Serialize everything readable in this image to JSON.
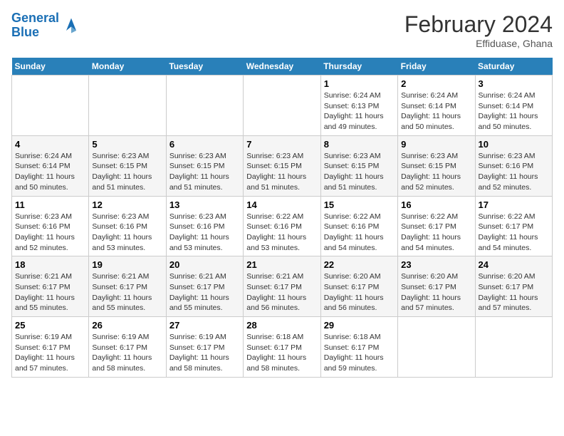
{
  "header": {
    "logo_line1": "General",
    "logo_line2": "Blue",
    "month_year": "February 2024",
    "location": "Effiduase, Ghana"
  },
  "days_of_week": [
    "Sunday",
    "Monday",
    "Tuesday",
    "Wednesday",
    "Thursday",
    "Friday",
    "Saturday"
  ],
  "weeks": [
    [
      {
        "num": "",
        "info": ""
      },
      {
        "num": "",
        "info": ""
      },
      {
        "num": "",
        "info": ""
      },
      {
        "num": "",
        "info": ""
      },
      {
        "num": "1",
        "info": "Sunrise: 6:24 AM\nSunset: 6:13 PM\nDaylight: 11 hours and 49 minutes."
      },
      {
        "num": "2",
        "info": "Sunrise: 6:24 AM\nSunset: 6:14 PM\nDaylight: 11 hours and 50 minutes."
      },
      {
        "num": "3",
        "info": "Sunrise: 6:24 AM\nSunset: 6:14 PM\nDaylight: 11 hours and 50 minutes."
      }
    ],
    [
      {
        "num": "4",
        "info": "Sunrise: 6:24 AM\nSunset: 6:14 PM\nDaylight: 11 hours and 50 minutes."
      },
      {
        "num": "5",
        "info": "Sunrise: 6:23 AM\nSunset: 6:15 PM\nDaylight: 11 hours and 51 minutes."
      },
      {
        "num": "6",
        "info": "Sunrise: 6:23 AM\nSunset: 6:15 PM\nDaylight: 11 hours and 51 minutes."
      },
      {
        "num": "7",
        "info": "Sunrise: 6:23 AM\nSunset: 6:15 PM\nDaylight: 11 hours and 51 minutes."
      },
      {
        "num": "8",
        "info": "Sunrise: 6:23 AM\nSunset: 6:15 PM\nDaylight: 11 hours and 51 minutes."
      },
      {
        "num": "9",
        "info": "Sunrise: 6:23 AM\nSunset: 6:15 PM\nDaylight: 11 hours and 52 minutes."
      },
      {
        "num": "10",
        "info": "Sunrise: 6:23 AM\nSunset: 6:16 PM\nDaylight: 11 hours and 52 minutes."
      }
    ],
    [
      {
        "num": "11",
        "info": "Sunrise: 6:23 AM\nSunset: 6:16 PM\nDaylight: 11 hours and 52 minutes."
      },
      {
        "num": "12",
        "info": "Sunrise: 6:23 AM\nSunset: 6:16 PM\nDaylight: 11 hours and 53 minutes."
      },
      {
        "num": "13",
        "info": "Sunrise: 6:23 AM\nSunset: 6:16 PM\nDaylight: 11 hours and 53 minutes."
      },
      {
        "num": "14",
        "info": "Sunrise: 6:22 AM\nSunset: 6:16 PM\nDaylight: 11 hours and 53 minutes."
      },
      {
        "num": "15",
        "info": "Sunrise: 6:22 AM\nSunset: 6:16 PM\nDaylight: 11 hours and 54 minutes."
      },
      {
        "num": "16",
        "info": "Sunrise: 6:22 AM\nSunset: 6:17 PM\nDaylight: 11 hours and 54 minutes."
      },
      {
        "num": "17",
        "info": "Sunrise: 6:22 AM\nSunset: 6:17 PM\nDaylight: 11 hours and 54 minutes."
      }
    ],
    [
      {
        "num": "18",
        "info": "Sunrise: 6:21 AM\nSunset: 6:17 PM\nDaylight: 11 hours and 55 minutes."
      },
      {
        "num": "19",
        "info": "Sunrise: 6:21 AM\nSunset: 6:17 PM\nDaylight: 11 hours and 55 minutes."
      },
      {
        "num": "20",
        "info": "Sunrise: 6:21 AM\nSunset: 6:17 PM\nDaylight: 11 hours and 55 minutes."
      },
      {
        "num": "21",
        "info": "Sunrise: 6:21 AM\nSunset: 6:17 PM\nDaylight: 11 hours and 56 minutes."
      },
      {
        "num": "22",
        "info": "Sunrise: 6:20 AM\nSunset: 6:17 PM\nDaylight: 11 hours and 56 minutes."
      },
      {
        "num": "23",
        "info": "Sunrise: 6:20 AM\nSunset: 6:17 PM\nDaylight: 11 hours and 57 minutes."
      },
      {
        "num": "24",
        "info": "Sunrise: 6:20 AM\nSunset: 6:17 PM\nDaylight: 11 hours and 57 minutes."
      }
    ],
    [
      {
        "num": "25",
        "info": "Sunrise: 6:19 AM\nSunset: 6:17 PM\nDaylight: 11 hours and 57 minutes."
      },
      {
        "num": "26",
        "info": "Sunrise: 6:19 AM\nSunset: 6:17 PM\nDaylight: 11 hours and 58 minutes."
      },
      {
        "num": "27",
        "info": "Sunrise: 6:19 AM\nSunset: 6:17 PM\nDaylight: 11 hours and 58 minutes."
      },
      {
        "num": "28",
        "info": "Sunrise: 6:18 AM\nSunset: 6:17 PM\nDaylight: 11 hours and 58 minutes."
      },
      {
        "num": "29",
        "info": "Sunrise: 6:18 AM\nSunset: 6:17 PM\nDaylight: 11 hours and 59 minutes."
      },
      {
        "num": "",
        "info": ""
      },
      {
        "num": "",
        "info": ""
      }
    ]
  ]
}
